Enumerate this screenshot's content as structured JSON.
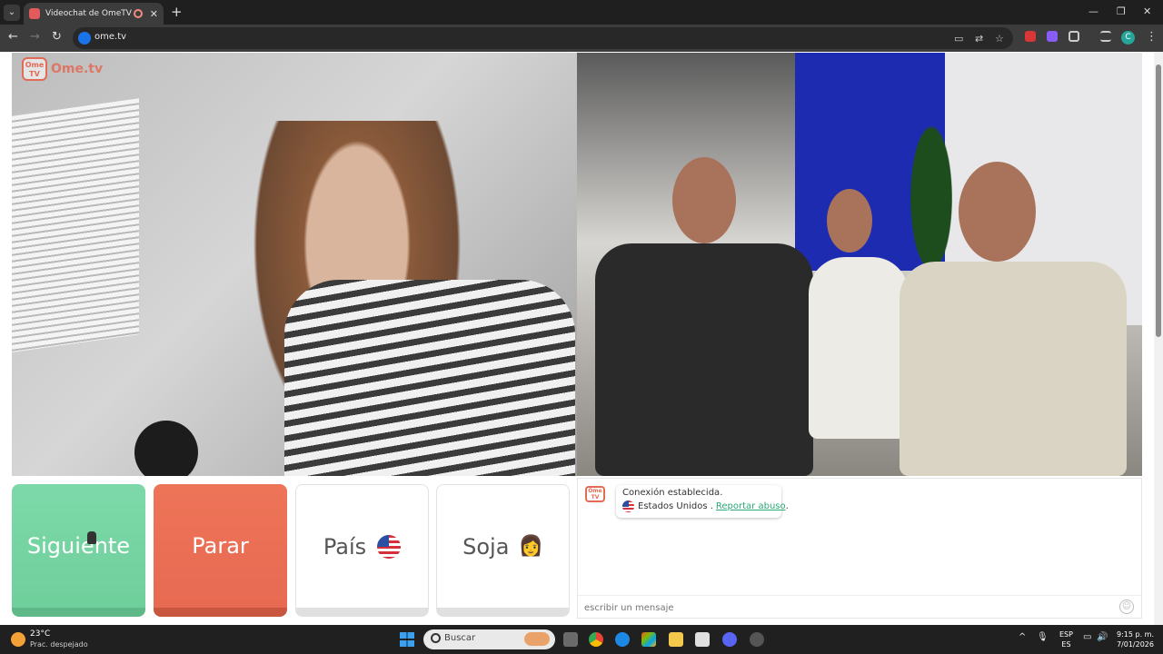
{
  "browser": {
    "tab_title": "Videochat de OmeTV: uno a",
    "tab_close": "✕",
    "new_tab": "+",
    "url": "ome.tv",
    "window_controls": {
      "minimize": "—",
      "maximize": "❐",
      "close": "✕"
    },
    "nav": {
      "back": "←",
      "forward": "→",
      "reload": "↻"
    },
    "icons": [
      "cast-icon",
      "translate-icon",
      "star-icon",
      "extensions-icon",
      "media-icon"
    ],
    "profile_initial": "C",
    "menu": "⋮"
  },
  "page": {
    "logo_badge": "Ome TV",
    "logo_text": "Ome.tv",
    "controls": {
      "next": "Siguiente",
      "stop": "Parar",
      "country": "País",
      "gender": "Soja",
      "gender_emoji": "👩"
    },
    "chat": {
      "logo": "Ome TV",
      "status": "Conexión establecida.",
      "country": "Estados Unidos .",
      "report": "Reportar abuso",
      "report_suffix": ".",
      "input_placeholder": "escribir un mensaje",
      "smiley": "☺"
    }
  },
  "taskbar": {
    "temperature": "23°C",
    "weather": "Prac. despejado",
    "search_label": "Buscar",
    "lang_top": "ESP",
    "lang_bottom": "ES",
    "time": "9:15 p. m.",
    "date": "7/01/2026",
    "tray": {
      "chevron": "^",
      "mic": "🎙",
      "display": "▭",
      "volume": "🔊"
    }
  },
  "colors": {
    "next": "#6fcf9b",
    "stop": "#e76a52",
    "brand": "#e26b55",
    "report_link": "#2aa876"
  }
}
